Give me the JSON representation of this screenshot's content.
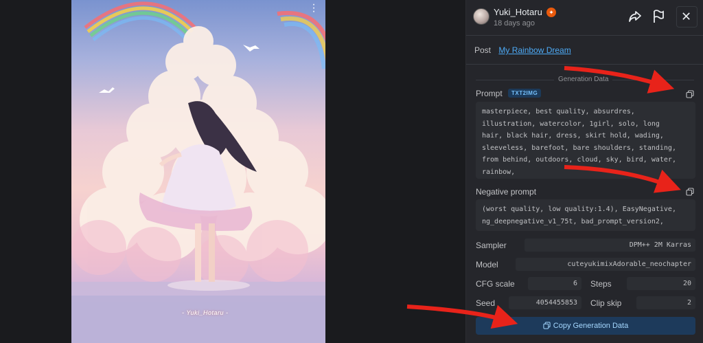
{
  "image": {
    "watermark": "- Yuki_Hotaru -"
  },
  "header": {
    "username": "Yuki_Hotaru",
    "timestamp": "18 days ago",
    "icons": [
      "share-icon",
      "flag-icon",
      "close-icon",
      "more-vertical-icon",
      "badge-icon"
    ]
  },
  "post": {
    "label": "Post",
    "title": "My Rainbow Dream"
  },
  "generation": {
    "section_title": "Generation Data",
    "prompt_label": "Prompt",
    "prompt_tag": "TXT2IMG",
    "prompt": "masterpiece, best quality, absurdres,\nillustration, watercolor, 1girl, solo, long\nhair, black hair, dress, skirt hold, wading,\nsleeveless, barefoot, bare shoulders, standing,\nfrom behind, outdoors, cloud, sky, bird, water,\nrainbow,",
    "negative_label": "Negative prompt",
    "negative_prompt": "(worst quality, low quality:1.4), EasyNegative,\nng_deepnegative_v1_75t, bad_prompt_version2,",
    "sampler_label": "Sampler",
    "sampler": "DPM++ 2M Karras",
    "model_label": "Model",
    "model": "cuteyukimixAdorable_neochapter",
    "cfg_label": "CFG scale",
    "cfg": "6",
    "steps_label": "Steps",
    "steps": "20",
    "seed_label": "Seed",
    "seed": "4054455853",
    "clip_label": "Clip skip",
    "clip": "2",
    "copy_button": "Copy Generation Data"
  },
  "colors": {
    "panel": "#25262b",
    "link": "#4dabf7",
    "annotation_arrow": "#e8231a"
  }
}
